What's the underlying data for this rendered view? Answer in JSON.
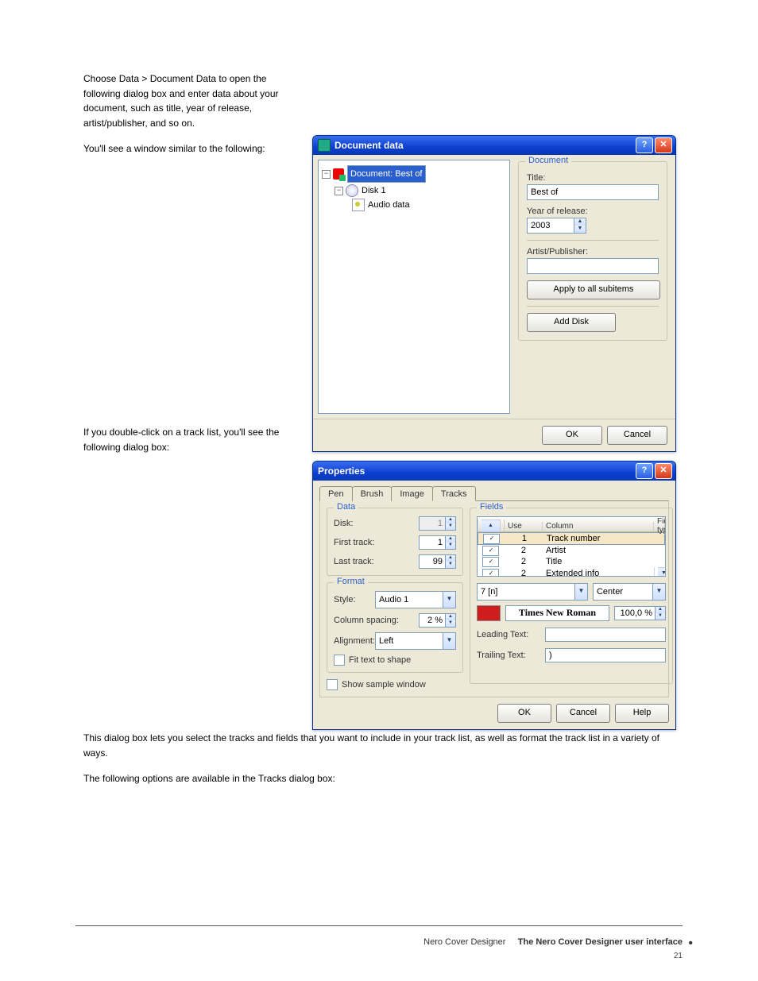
{
  "intro": {
    "p1": "Choose Data > Document Data to open the following dialog box and enter data about your document, such as title, year of release, artist/publisher, and so on.",
    "p2": "You'll see a window similar to the following:"
  },
  "mid": {
    "p1": "If you double-click on a track list, you'll see the following dialog box:"
  },
  "low": {
    "p1": "This dialog box lets you select the tracks and fields that you want to include in your track list, as well as format the track list in a variety of ways.",
    "p2": "The following options are available in the Tracks dialog box:"
  },
  "footer": {
    "manual": "Nero Cover Designer",
    "section": "The Nero Cover Designer user interface",
    "page": "21"
  },
  "docwin": {
    "title": "Document data",
    "tree": {
      "root": "Document: Best of",
      "disk": "Disk 1",
      "audio": "Audio data"
    },
    "group": "Document",
    "title_lbl": "Title:",
    "title_val": "Best of",
    "year_lbl": "Year of release:",
    "year_val": "2003",
    "artist_lbl": "Artist/Publisher:",
    "artist_val": "",
    "apply_btn": "Apply to all subitems",
    "adddisk_btn": "Add Disk",
    "ok": "OK",
    "cancel": "Cancel"
  },
  "propwin": {
    "title": "Properties",
    "tabs": {
      "pen": "Pen",
      "brush": "Brush",
      "image": "Image",
      "tracks": "Tracks"
    },
    "data": {
      "legend": "Data",
      "disk_lbl": "Disk:",
      "disk_val": "1",
      "first_lbl": "First track:",
      "first_val": "1",
      "last_lbl": "Last track:",
      "last_val": "99"
    },
    "format": {
      "legend": "Format",
      "style_lbl": "Style:",
      "style_val": "Audio 1",
      "colsp_lbl": "Column spacing:",
      "colsp_val": "2 %",
      "align_lbl": "Alignment:",
      "align_val": "Left",
      "fit_lbl": "Fit text to shape"
    },
    "show_sample": "Show sample window",
    "fields": {
      "legend": "Fields",
      "headers": {
        "use": "Use",
        "column": "Column",
        "fieldtype": "Field type"
      },
      "rows": [
        {
          "checked": true,
          "col": "1",
          "type": "Track number",
          "sel": true
        },
        {
          "checked": true,
          "col": "2",
          "type": "Artist",
          "sel": false
        },
        {
          "checked": true,
          "col": "2",
          "type": "Title",
          "sel": false
        },
        {
          "checked": true,
          "col": "2",
          "type": "Extended info",
          "sel": false
        }
      ],
      "fmt_sel": "7 [n]",
      "align_sel": "Center",
      "font_color": "#d01c1c",
      "font_name": "Times New Roman",
      "font_pct": "100,0 %",
      "leading_lbl": "Leading Text:",
      "leading_val": "",
      "trailing_lbl": "Trailing Text:",
      "trailing_val": ")"
    },
    "ok": "OK",
    "cancel": "Cancel",
    "help": "Help"
  }
}
